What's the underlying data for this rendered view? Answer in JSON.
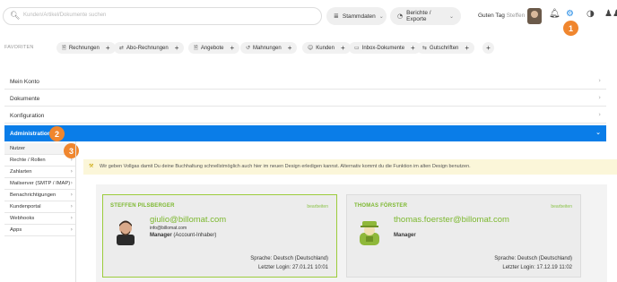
{
  "header": {
    "search_placeholder": "Kunden/Artikel/Dokumente suchen",
    "stammdaten_label": "Stammdaten",
    "berichte_label": "Berichte / Exporte",
    "greeting": "Guten Tag",
    "greeting_name": "Steffen",
    "icons": [
      "bell-icon",
      "gear-icon",
      "globe-icon",
      "users-icon"
    ]
  },
  "callouts": [
    "1",
    "2",
    "3"
  ],
  "favorites": {
    "label": "FAVORITEN",
    "items": [
      {
        "label": "Rechnungen",
        "icon": "document-icon"
      },
      {
        "label": "Abo-Rechnungen",
        "icon": "refresh-icon"
      },
      {
        "label": "Angebote",
        "icon": "document-icon"
      },
      {
        "label": "Mahnungen",
        "icon": "history-icon"
      },
      {
        "label": "Kunden",
        "icon": "person-icon"
      },
      {
        "label": "Inbox-Dokumente",
        "icon": "inbox-icon"
      },
      {
        "label": "Gutschriften",
        "icon": "exchange-icon"
      }
    ],
    "plus": "+"
  },
  "accordion": [
    {
      "label": "Mein Konto"
    },
    {
      "label": "Dokumente"
    },
    {
      "label": "Konfiguration"
    },
    {
      "label": "Administration"
    }
  ],
  "submenu": [
    {
      "label": "Nutzer"
    },
    {
      "label": "Rechte / Rollen"
    },
    {
      "label": "Zahlarten"
    },
    {
      "label": "Mailserver (SMTP / IMAP)"
    },
    {
      "label": "Benachrichtigungen"
    },
    {
      "label": "Kundenportal"
    },
    {
      "label": "Webhooks"
    },
    {
      "label": "Apps"
    }
  ],
  "notice": {
    "text": "Wir geben Vollgas damit Du deine Buchhaltung schnellstmöglich auch hier im neuen Design erledigen kannst. Alternativ kommt du die Funktion im alten Design benutzen."
  },
  "users": [
    {
      "name": "STEFFEN PILSBERGER",
      "edit": "bearbeiten",
      "email": "giulio@billomat.com",
      "email2": "info@billomat.com",
      "role": "Manager",
      "role_note": "(Account-Inhaber)",
      "language": "Sprache: Deutsch (Deutschland)",
      "last_login": "Letzter Login: 27.01.21 10:01"
    },
    {
      "name": "THOMAS FÖRSTER",
      "edit": "bearbeiten",
      "email": "thomas.foerster@billomat.com",
      "role": "Manager",
      "language": "Sprache: Deutsch (Deutschland)",
      "last_login": "Letzter Login: 17.12.19 11:02"
    }
  ],
  "colors": {
    "accent_blue": "#0a7de8",
    "callout_orange": "#f0862e",
    "user_green": "#7cb82f",
    "notice_bg": "#fbf6d9"
  }
}
